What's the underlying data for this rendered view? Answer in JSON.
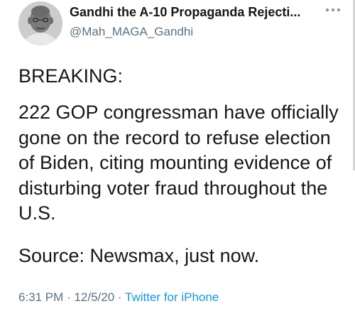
{
  "author": {
    "display_name": "Gandhi the A-10 Propaganda Rejecti...",
    "handle": "@Mah_MAGA_Gandhi",
    "avatar_icon": "grayscale-portrait-avatar"
  },
  "more_icon": "more-dots-icon",
  "tweet": {
    "breaking": "BREAKING:",
    "body_lines": [
      "222 GOP congressman have officially",
      "gone on the record to refuse election",
      "of Biden, citing mounting evidence of",
      "disturbing voter fraud throughout the",
      "U.S."
    ],
    "source": "Source: Newsmax, just now."
  },
  "meta": {
    "time": "6:31 PM",
    "separator": "·",
    "date": "12/5/20",
    "app": "Twitter for iPhone"
  },
  "colors": {
    "text": "#14171a",
    "secondary": "#5b7083",
    "link": "#1b95e0"
  }
}
